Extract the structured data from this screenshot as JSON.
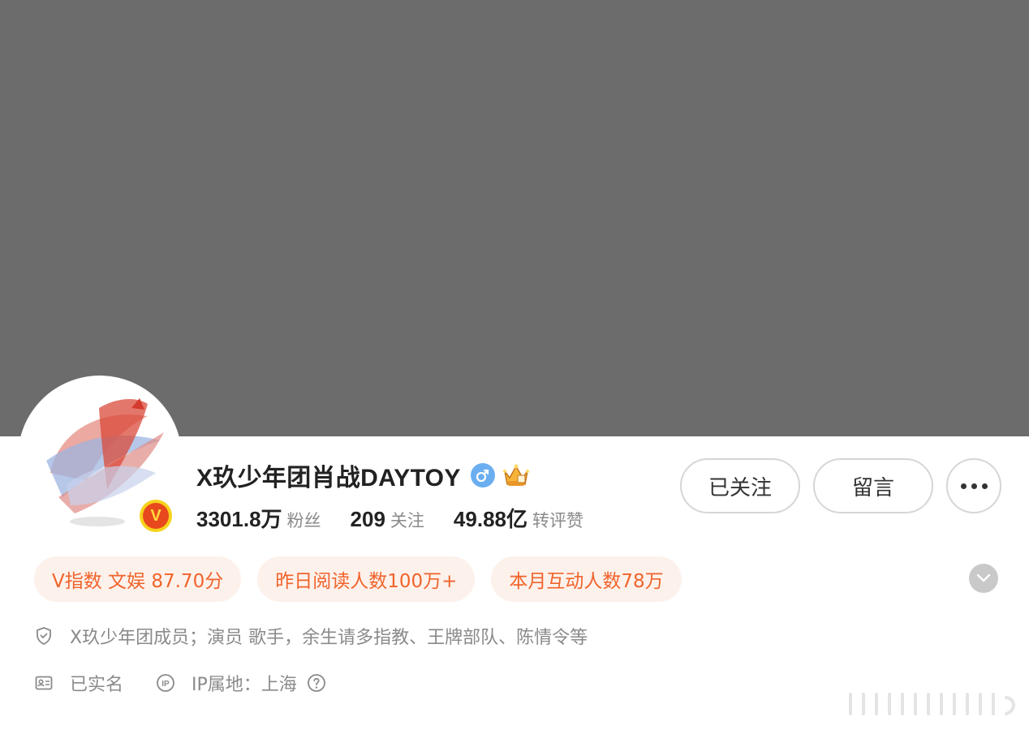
{
  "profile": {
    "name": "X玖少年团肖战DAYTOY",
    "verify_badge_letter": "V",
    "gender_icon": "male-icon",
    "stats": [
      {
        "value": "3301.8万",
        "label": "粉丝"
      },
      {
        "value": "209",
        "label": "关注"
      },
      {
        "value": "49.88亿",
        "label": "转评赞"
      }
    ]
  },
  "actions": {
    "follow_label": "已关注",
    "message_label": "留言"
  },
  "tags": [
    {
      "text": "V指数 文娱 87.70分"
    },
    {
      "text": "昨日阅读人数100万+"
    },
    {
      "text": "本月互动人数78万"
    }
  ],
  "info": {
    "bio": "X玖少年团成员；演员 歌手，余生请多指教、王牌部队、陈情令等",
    "realname": "已实名",
    "ip_location": "IP属地：上海"
  },
  "colors": {
    "cover": "#6c6c6c",
    "accent": "#f0642c",
    "tag_bg": "#fdf1eb",
    "verify_yellow": "#f7d21c",
    "verify_orange": "#e8481e"
  }
}
